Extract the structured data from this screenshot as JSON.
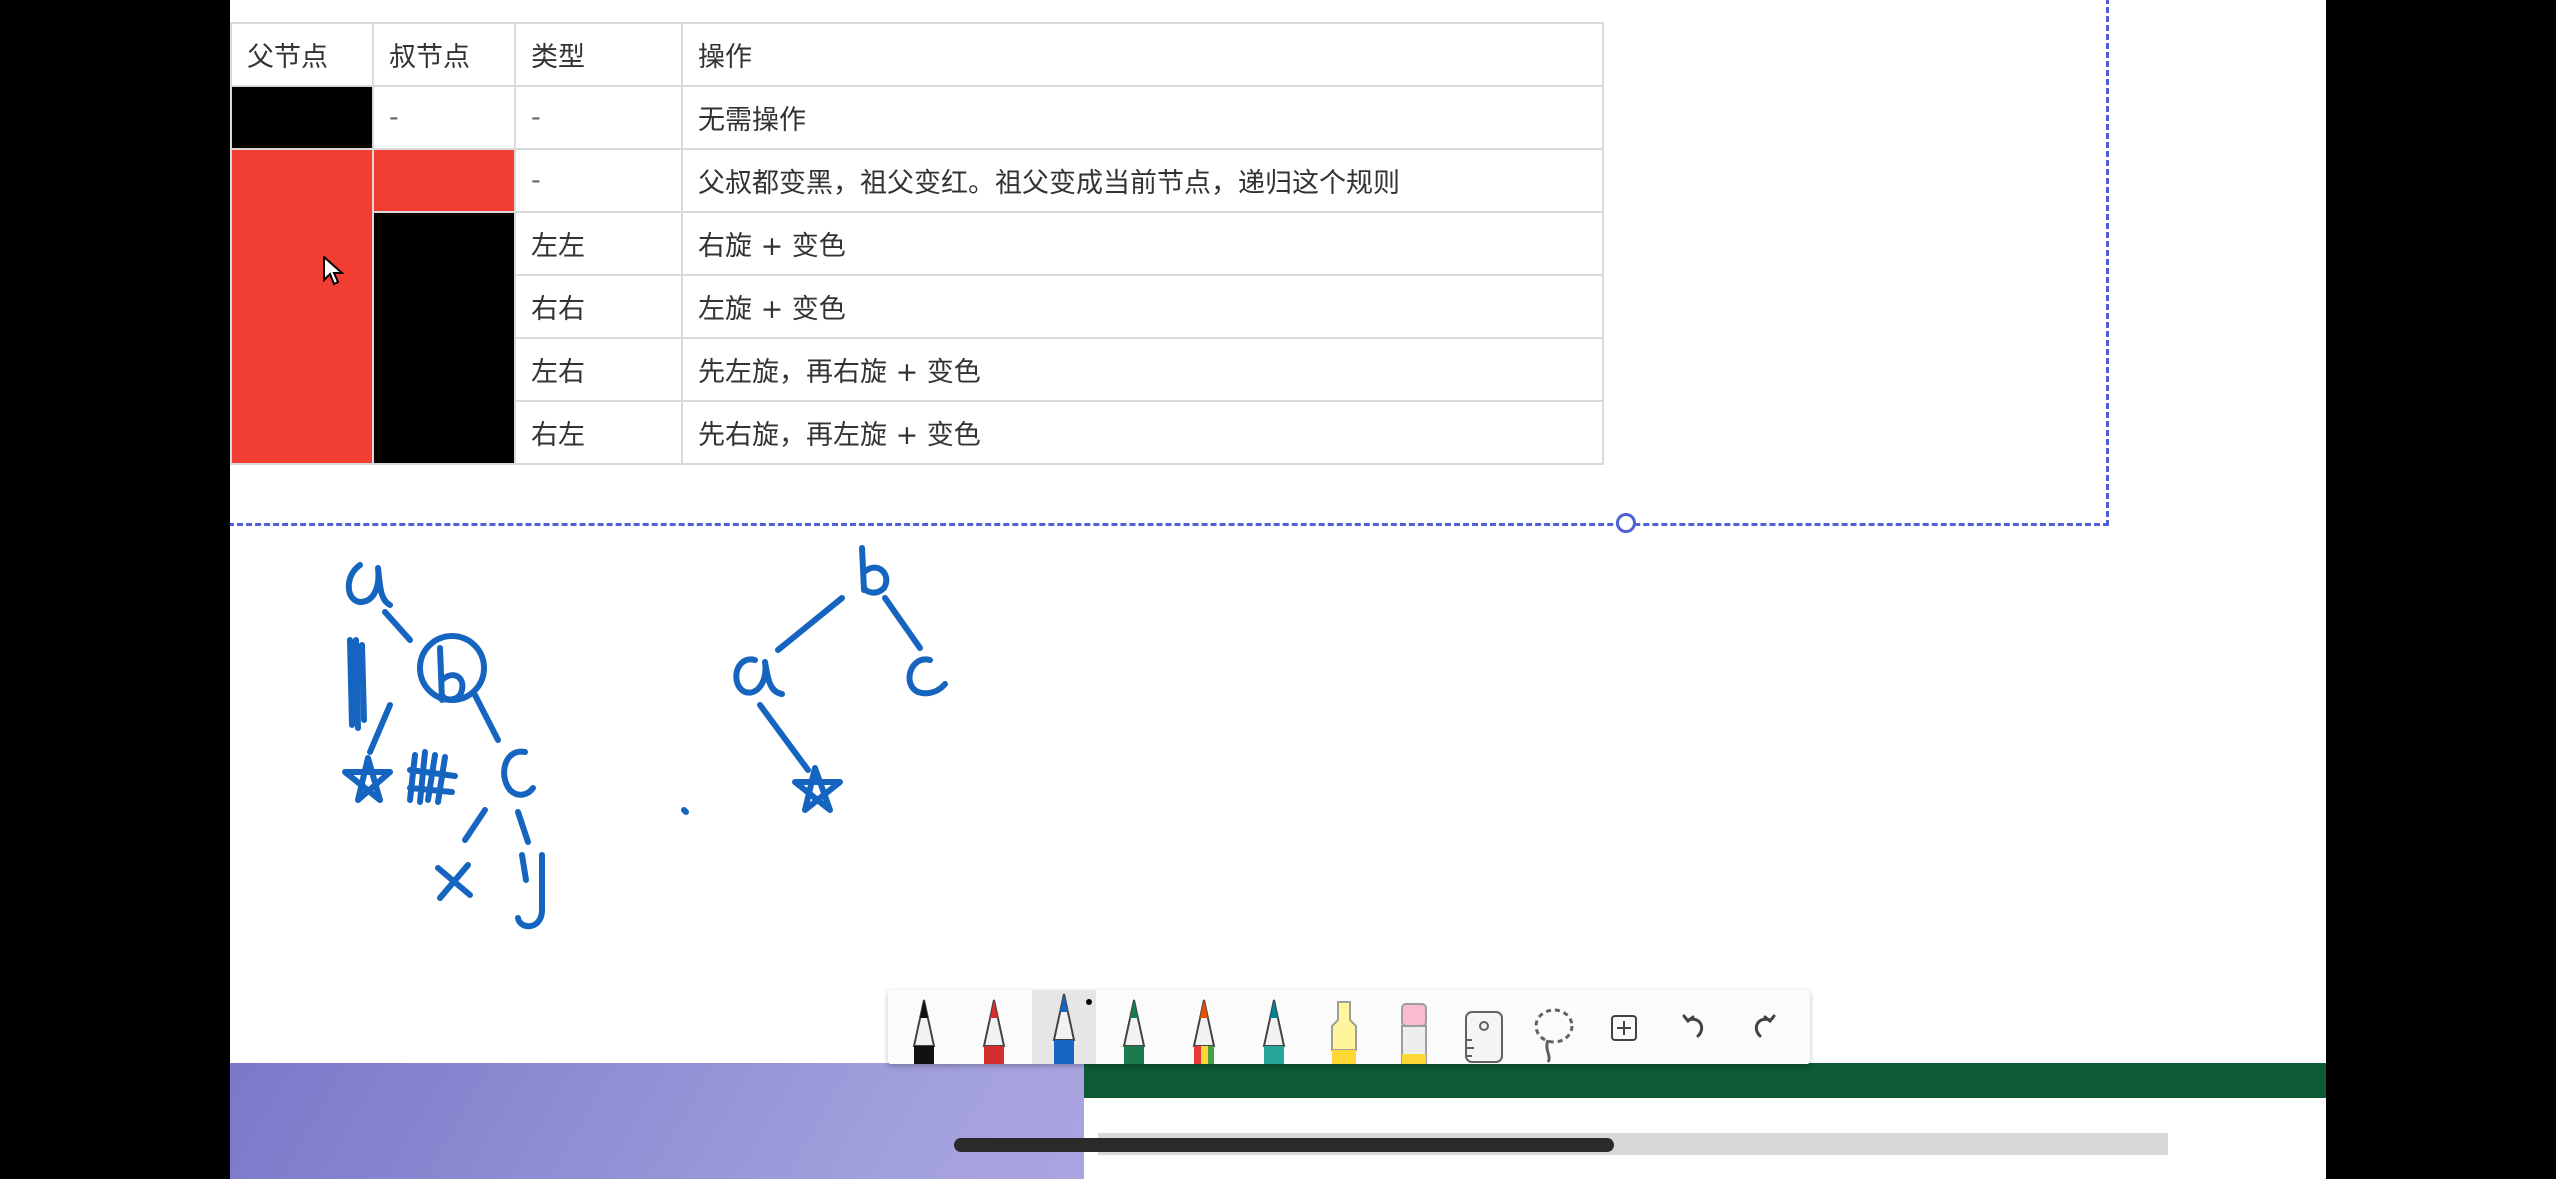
{
  "table": {
    "headers": [
      "父节点",
      "叔节点",
      "类型",
      "操作"
    ],
    "rows": [
      {
        "parent_color": "#000000",
        "uncle": "-",
        "type": "-",
        "operation": "无需操作"
      },
      {
        "parent_color": "#f23d32",
        "uncle_color": "#f23d32",
        "type": "-",
        "operation": "父叔都变黑，祖父变红。祖父变成当前节点，递归这个规则"
      },
      {
        "uncle_color": "#000000",
        "type": "左左",
        "operation": "右旋 + 变色"
      },
      {
        "type": "右右",
        "operation": "左旋 + 变色"
      },
      {
        "type": "左右",
        "operation": "先左旋，再右旋 + 变色"
      },
      {
        "type": "右左",
        "operation": "先右旋，再左旋 + 变色"
      }
    ]
  },
  "colors": {
    "red_node": "#f23d32",
    "black_node": "#000000",
    "ink": "#1565c0",
    "selection_border": "#4f5fd6",
    "taskbar_green": "#0d5a35"
  },
  "toolbar": {
    "tools": [
      {
        "name": "black-pen-icon"
      },
      {
        "name": "red-pen-icon"
      },
      {
        "name": "blue-pen-icon",
        "active": true
      },
      {
        "name": "green-pen-icon"
      },
      {
        "name": "rainbow-pen-icon"
      },
      {
        "name": "galaxy-pen-icon"
      },
      {
        "name": "yellow-highlighter-icon"
      },
      {
        "name": "eraser-icon"
      },
      {
        "name": "ruler-icon"
      },
      {
        "name": "lasso-icon"
      },
      {
        "name": "add-tool-icon"
      },
      {
        "name": "undo-icon"
      },
      {
        "name": "redo-icon"
      }
    ]
  }
}
